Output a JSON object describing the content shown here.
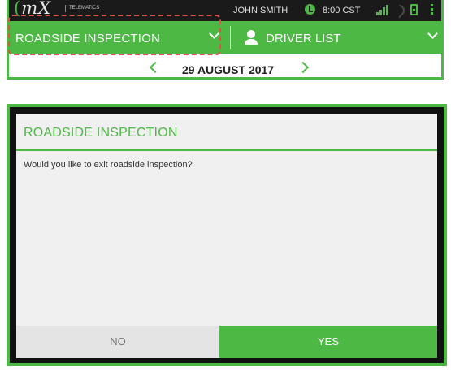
{
  "status_bar": {
    "logo_text": "mX",
    "logo_sub": "TELEMATICS",
    "user_name": "JOHN SMITH",
    "time": "8:00 CST",
    "icons": [
      "clock-icon",
      "signal-icon",
      "wifi-icon",
      "device-icon",
      "menu-icon"
    ]
  },
  "nav": {
    "left_label": "ROADSIDE INSPECTION",
    "right_label": "DRIVER LIST"
  },
  "date_bar": {
    "date": "29 AUGUST 2017"
  },
  "dialog": {
    "title": "ROADSIDE INSPECTION",
    "message": "Would you like to exit roadside inspection?",
    "no_label": "NO",
    "yes_label": "YES"
  },
  "colors": {
    "accent": "#4db843",
    "status_bar_bg": "#1a1a1a",
    "highlight_dashed": "#e0504a",
    "dialog_bg": "#f0f0f0"
  }
}
